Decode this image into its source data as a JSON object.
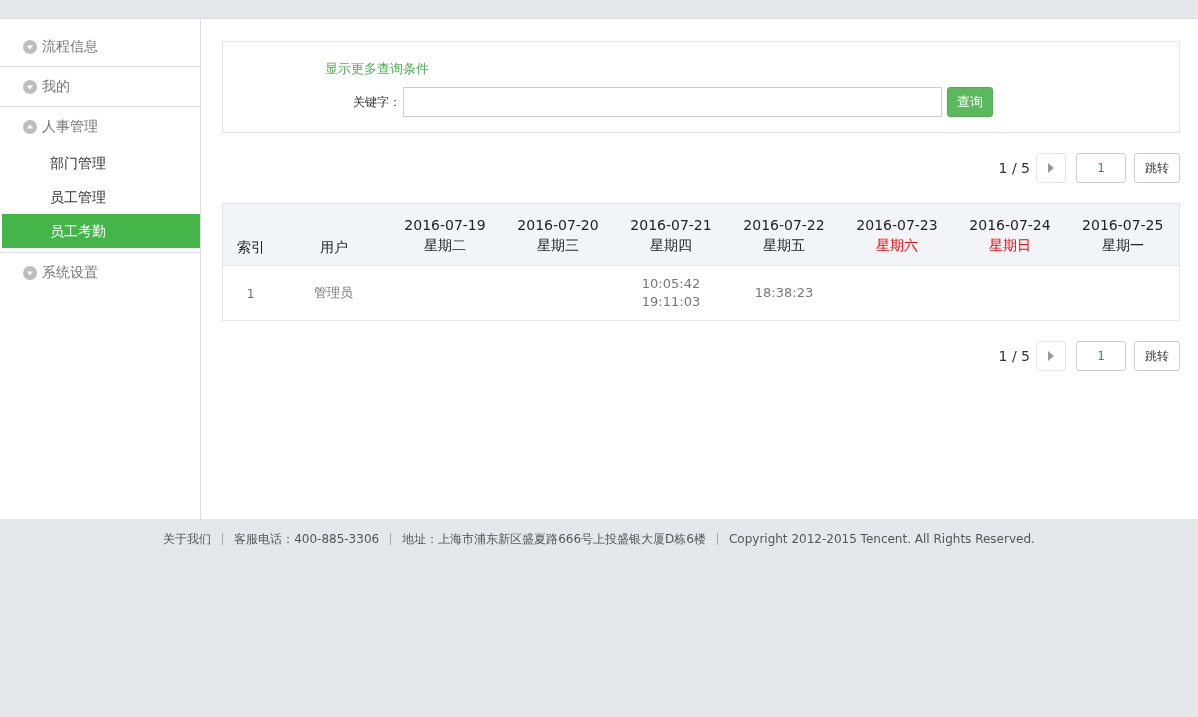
{
  "sidebar": {
    "groups": [
      {
        "label": "流程信息",
        "expanded": false
      },
      {
        "label": "我的",
        "expanded": false
      },
      {
        "label": "人事管理",
        "expanded": true,
        "children": [
          {
            "label": "部门管理",
            "selected": false
          },
          {
            "label": "员工管理",
            "selected": false
          },
          {
            "label": "员工考勤",
            "selected": true
          }
        ]
      },
      {
        "label": "系统设置",
        "expanded": false
      }
    ]
  },
  "search": {
    "more_link": "显示更多查询条件",
    "keyword_label": "关键字：",
    "button": "查询"
  },
  "pager_top": {
    "page_info": "1 / 5",
    "page_input": "1",
    "jump_button": "跳转"
  },
  "table": {
    "index_header": "索引",
    "user_header": "用户",
    "days": [
      {
        "date": "2016-07-19",
        "weekday": "星期二",
        "weekend": false
      },
      {
        "date": "2016-07-20",
        "weekday": "星期三",
        "weekend": false
      },
      {
        "date": "2016-07-21",
        "weekday": "星期四",
        "weekend": false
      },
      {
        "date": "2016-07-22",
        "weekday": "星期五",
        "weekend": false
      },
      {
        "date": "2016-07-23",
        "weekday": "星期六",
        "weekend": true
      },
      {
        "date": "2016-07-24",
        "weekday": "星期日",
        "weekend": true
      },
      {
        "date": "2016-07-25",
        "weekday": "星期一",
        "weekend": false
      }
    ],
    "rows": [
      {
        "index": "1",
        "user": "管理员",
        "days": [
          {
            "punched": false
          },
          {
            "punched": false
          },
          {
            "punched": true,
            "times": [
              "10:05:42",
              "19:11:03"
            ]
          },
          {
            "punched": true,
            "times": [
              "18:38:23"
            ]
          },
          {
            "punched": false
          },
          {
            "punched": false
          },
          {
            "punched": false
          }
        ]
      }
    ]
  },
  "pager_bottom": {
    "page_info": "1 / 5",
    "page_input": "1",
    "jump_button": "跳转"
  },
  "footer": {
    "items": [
      "关于我们",
      "客服电话：400-885-3306",
      "地址：上海市浦东新区盛夏路666号上投盛银大厦D栋6楼",
      "Copyright 2012-2015 Tencent. All Rights Reserved."
    ]
  }
}
